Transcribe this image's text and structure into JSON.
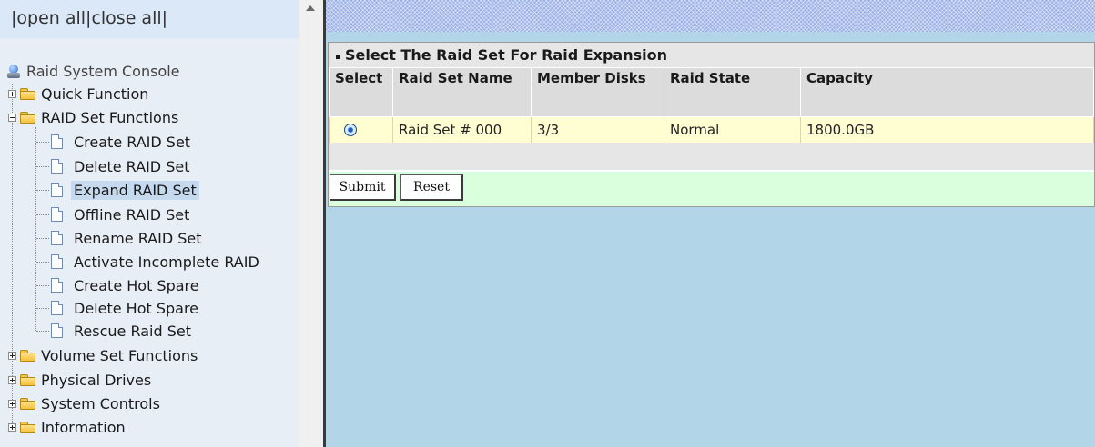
{
  "tree": {
    "links": "|open all|close all|",
    "root": "Raid System Console",
    "folders": {
      "quick": "Quick Function",
      "raid_set": "RAID Set Functions",
      "volume": "Volume Set Functions",
      "physical": "Physical Drives",
      "system": "System Controls",
      "info": "Information"
    },
    "raid_items": [
      "Create RAID Set",
      "Delete RAID Set",
      "Expand RAID Set",
      "Offline RAID Set",
      "Rename RAID Set",
      "Activate Incomplete RAID",
      "Create Hot Spare",
      "Delete Hot Spare",
      "Rescue Raid Set"
    ],
    "selected_item": "Expand RAID Set"
  },
  "panel": {
    "title": "Select The Raid Set For Raid Expansion",
    "columns": [
      "Select",
      "Raid Set Name",
      "Member Disks",
      "Raid State",
      "Capacity"
    ],
    "rows": [
      {
        "selected": true,
        "name": "Raid Set # 000",
        "member_disks": "3/3",
        "state": "Normal",
        "capacity": "1800.0GB"
      }
    ],
    "submit_label": "Submit",
    "reset_label": "Reset"
  },
  "colors": {
    "content_bg": "#b2d5e7",
    "row_bg": "#fffed3",
    "button_bar_bg": "#daffdc",
    "selected_item_bg": "#c5d9ef"
  },
  "icons": {
    "root": "console-icon",
    "folder": "folder-icon",
    "page": "document-icon",
    "expand": "plus-box-icon",
    "collapse": "minus-box-icon",
    "radio": "radio-selected-icon",
    "scroll": "scroll-up-arrow-icon"
  }
}
